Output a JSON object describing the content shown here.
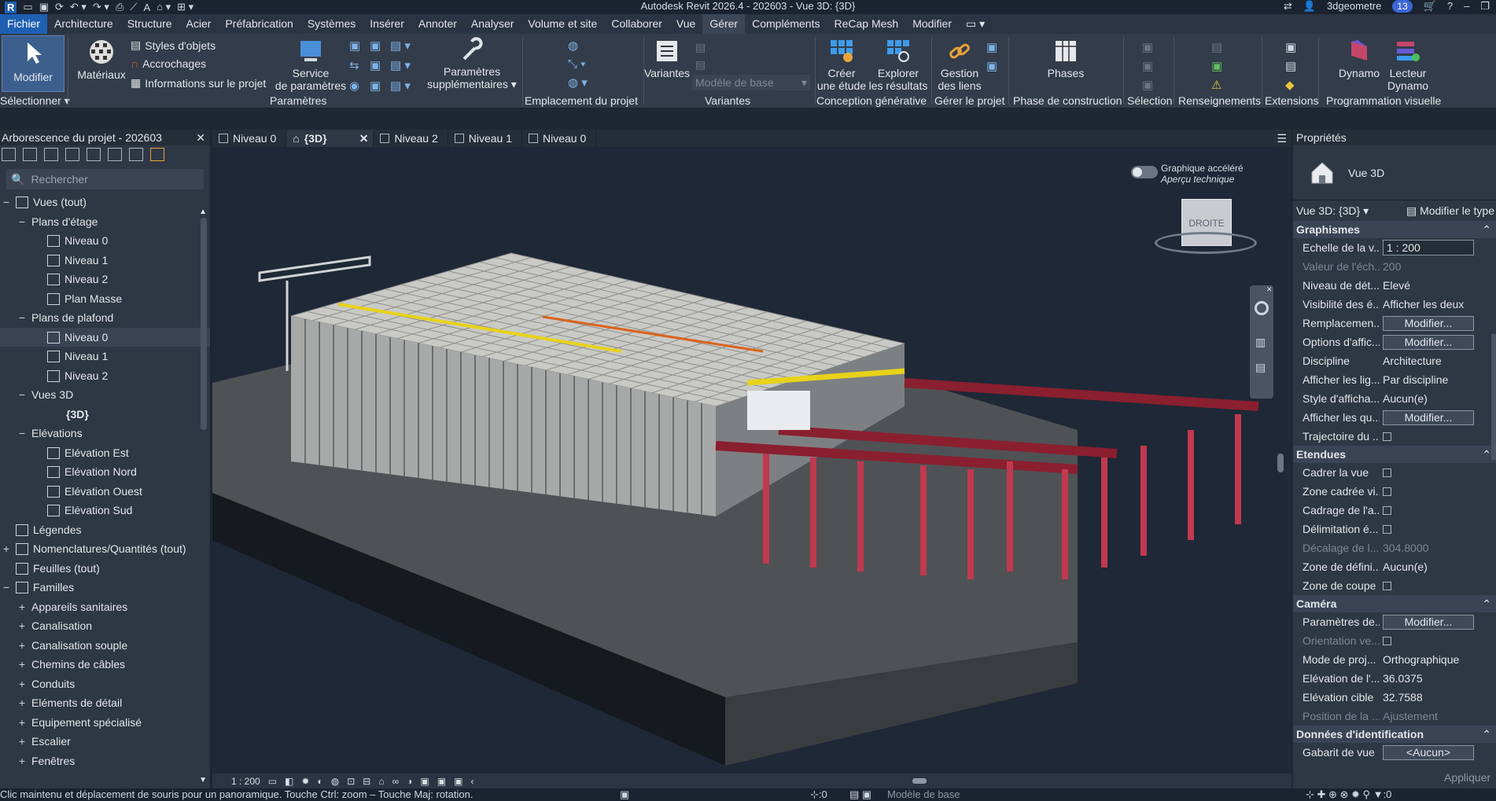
{
  "app": {
    "title": "Autodesk Revit 2026.4 - 202603 - Vue 3D: {3D}",
    "user": "3dgeometre",
    "notifications": "13"
  },
  "menu": [
    "Fichier",
    "Architecture",
    "Structure",
    "Acier",
    "Préfabrication",
    "Systèmes",
    "Insérer",
    "Annoter",
    "Analyser",
    "Volume et site",
    "Collaborer",
    "Vue",
    "Gérer",
    "Compléments",
    "ReCap Mesh",
    "Modifier"
  ],
  "ribbon": {
    "modifier": "Modifier",
    "selectionner": "Sélectionner",
    "materiaux": "Matériaux",
    "styles_objets": "Styles d'objets",
    "accrochages": "Accrochages",
    "infos_projet": "Informations sur le projet",
    "service_parametres_1": "Service",
    "service_parametres_2": "de paramètres",
    "params_supp_1": "Paramètres",
    "params_supp_2": "supplémentaires",
    "panel_parametres": "Paramètres",
    "panel_emplacement": "Emplacement du projet",
    "variantes": "Variantes",
    "modele_base": "Modèle de base",
    "panel_variantes": "Variantes",
    "creer_etude_1": "Créer",
    "creer_etude_2": "une étude",
    "explorer_1": "Explorer",
    "explorer_2": "les résultats",
    "panel_conception": "Conception générative",
    "gestion_liens_1": "Gestion",
    "gestion_liens_2": "des liens",
    "panel_gerer": "Gérer le projet",
    "phases": "Phases",
    "panel_phase": "Phase de construction",
    "panel_selection": "Sélection",
    "panel_renseignements": "Renseignements",
    "panel_extensions": "Extensions",
    "dynamo": "Dynamo",
    "lecteur_1": "Lecteur",
    "lecteur_2": "Dynamo",
    "panel_prog": "Programmation visuelle"
  },
  "project_browser": {
    "title": "Arborescence du projet - 202603",
    "search_placeholder": "Rechercher",
    "items": [
      {
        "label": "Vues (tout)",
        "level": 0,
        "toggle": "−",
        "icon": "views"
      },
      {
        "label": "Plans d'étage",
        "level": 1,
        "toggle": "−"
      },
      {
        "label": "Niveau 0",
        "level": 2,
        "icon": "view"
      },
      {
        "label": "Niveau 1",
        "level": 2,
        "icon": "view"
      },
      {
        "label": "Niveau 2",
        "level": 2,
        "icon": "view"
      },
      {
        "label": "Plan Masse",
        "level": 2,
        "icon": "view"
      },
      {
        "label": "Plans de plafond",
        "level": 1,
        "toggle": "−"
      },
      {
        "label": "Niveau 0",
        "level": 2,
        "icon": "view",
        "selected": true
      },
      {
        "label": "Niveau 1",
        "level": 2,
        "icon": "view"
      },
      {
        "label": "Niveau 2",
        "level": 2,
        "icon": "view"
      },
      {
        "label": "Vues 3D",
        "level": 1,
        "toggle": "−"
      },
      {
        "label": "{3D}",
        "level": 2,
        "bold": true
      },
      {
        "label": "Elévations",
        "level": 1,
        "toggle": "−"
      },
      {
        "label": "Elévation Est",
        "level": 2,
        "icon": "view"
      },
      {
        "label": "Elévation Nord",
        "level": 2,
        "icon": "view"
      },
      {
        "label": "Elévation Ouest",
        "level": 2,
        "icon": "view"
      },
      {
        "label": "Elévation Sud",
        "level": 2,
        "icon": "view"
      },
      {
        "label": "Légendes",
        "level": 0,
        "icon": "legend"
      },
      {
        "label": "Nomenclatures/Quantités (tout)",
        "level": 0,
        "toggle": "+",
        "icon": "table"
      },
      {
        "label": "Feuilles (tout)",
        "level": 0,
        "icon": "sheet"
      },
      {
        "label": "Familles",
        "level": 0,
        "toggle": "−",
        "icon": "family"
      },
      {
        "label": "Appareils sanitaires",
        "level": 1,
        "toggle": "+"
      },
      {
        "label": "Canalisation",
        "level": 1,
        "toggle": "+"
      },
      {
        "label": "Canalisation souple",
        "level": 1,
        "toggle": "+"
      },
      {
        "label": "Chemins de câbles",
        "level": 1,
        "toggle": "+"
      },
      {
        "label": "Conduits",
        "level": 1,
        "toggle": "+"
      },
      {
        "label": "Eléments de détail",
        "level": 1,
        "toggle": "+"
      },
      {
        "label": "Equipement spécialisé",
        "level": 1,
        "toggle": "+"
      },
      {
        "label": "Escalier",
        "level": 1,
        "toggle": "+"
      },
      {
        "label": "Fenêtres",
        "level": 1,
        "toggle": "+"
      }
    ]
  },
  "view_tabs": [
    {
      "label": "Niveau 0",
      "active": false
    },
    {
      "label": "{3D}",
      "active": true
    },
    {
      "label": "Niveau 2",
      "active": false
    },
    {
      "label": "Niveau 1",
      "active": false
    },
    {
      "label": "Niveau 0",
      "active": false
    }
  ],
  "viewport": {
    "toggle_label": "Graphique accéléré",
    "toggle_sub": "Aperçu technique",
    "viewcube_label": "DROITE",
    "scale": "1 : 200"
  },
  "properties": {
    "title": "Propriétés",
    "type_name": "Vue 3D",
    "type_selector": "Vue 3D: {3D}",
    "edit_type": "Modifier le type",
    "groups": [
      {
        "name": "Graphismes",
        "rows": [
          {
            "k": "Echelle de la v...",
            "v": "1 : 200",
            "kind": "input"
          },
          {
            "k": "Valeur de l'éch...",
            "v": "200",
            "disabled": true
          },
          {
            "k": "Niveau de dét...",
            "v": "Elevé"
          },
          {
            "k": "Visibilité des é...",
            "v": "Afficher les deux"
          },
          {
            "k": "Remplacemen...",
            "v": "Modifier...",
            "kind": "button"
          },
          {
            "k": "Options d'affic...",
            "v": "Modifier...",
            "kind": "button"
          },
          {
            "k": "Discipline",
            "v": "Architecture"
          },
          {
            "k": "Afficher les lig...",
            "v": "Par discipline"
          },
          {
            "k": "Style d'afficha...",
            "v": "Aucun(e)"
          },
          {
            "k": "Afficher les qu...",
            "v": "Modifier...",
            "kind": "button"
          },
          {
            "k": "Trajectoire du ...",
            "v": "",
            "kind": "check"
          }
        ]
      },
      {
        "name": "Etendues",
        "rows": [
          {
            "k": "Cadrer la vue",
            "v": "",
            "kind": "check"
          },
          {
            "k": "Zone cadrée vi...",
            "v": "",
            "kind": "check"
          },
          {
            "k": "Cadrage de l'a...",
            "v": "",
            "kind": "check"
          },
          {
            "k": "Délimitation é...",
            "v": "",
            "kind": "check"
          },
          {
            "k": "Décalage de l...",
            "v": "304.8000",
            "disabled": true
          },
          {
            "k": "Zone de défini...",
            "v": "Aucun(e)"
          },
          {
            "k": "Zone de coupe",
            "v": "",
            "kind": "check"
          }
        ]
      },
      {
        "name": "Caméra",
        "rows": [
          {
            "k": "Paramètres de...",
            "v": "Modifier...",
            "kind": "button"
          },
          {
            "k": "Orientation ve...",
            "v": "",
            "kind": "check",
            "disabled": true
          },
          {
            "k": "Mode de proj...",
            "v": "Orthographique"
          },
          {
            "k": "Elévation de l'...",
            "v": "36.0375"
          },
          {
            "k": "Elévation cible",
            "v": "32.7588"
          },
          {
            "k": "Position de la ...",
            "v": "Ajustement",
            "disabled": true
          }
        ]
      },
      {
        "name": "Données d'identification",
        "rows": [
          {
            "k": "Gabarit de vue",
            "v": "<Aucun>",
            "kind": "button"
          }
        ]
      }
    ],
    "apply": "Appliquer"
  },
  "statusbar": {
    "message": "Clic maintenu et déplacement de souris pour un panoramique. Touche Ctrl: zoom – Touche Maj: rotation.",
    "model": "Modèle de base",
    "counter": "0"
  },
  "colors": {
    "accent": "#1e5fb3",
    "steel_red": "#8a1f2f",
    "yellow": "#e8d21a"
  }
}
